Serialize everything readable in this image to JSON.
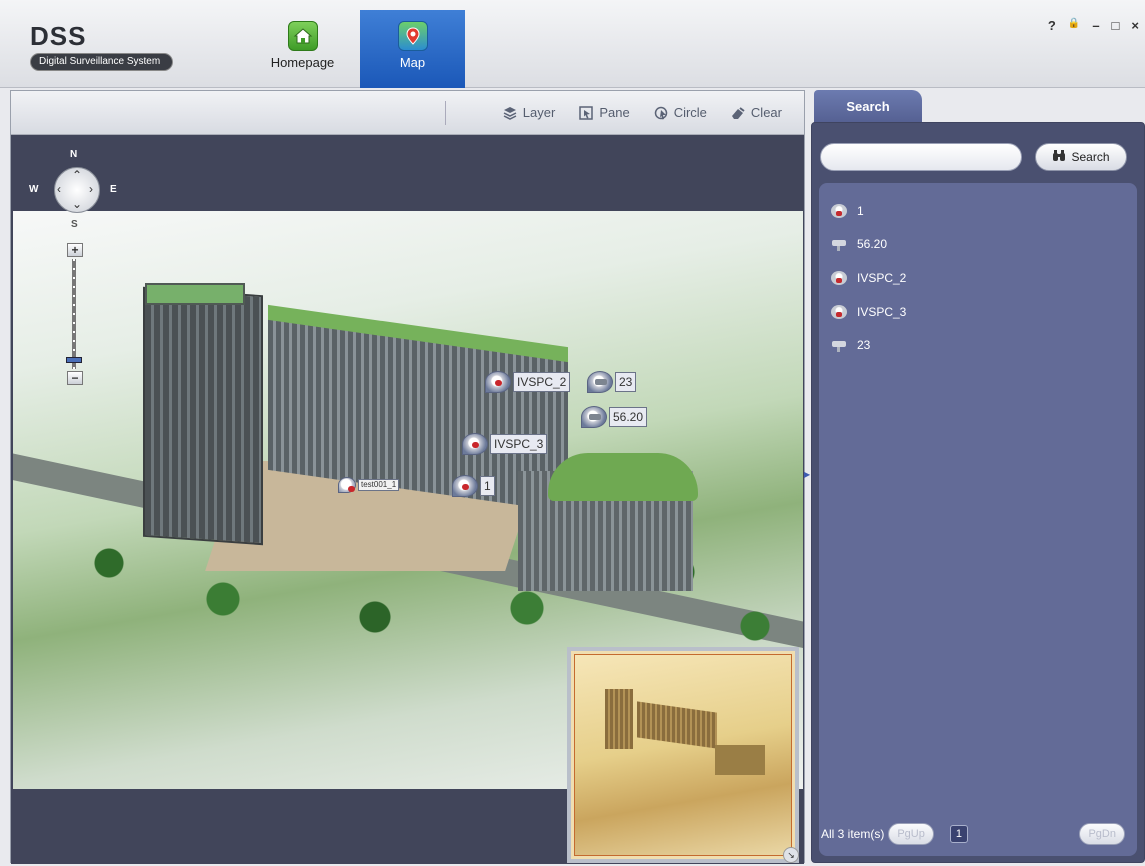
{
  "app": {
    "title": "DSS",
    "subtitle": "Digital Surveillance System"
  },
  "nav": {
    "tabs": [
      {
        "label": "Homepage",
        "icon": "house-icon",
        "active": false
      },
      {
        "label": "Map",
        "icon": "map-pin-icon",
        "active": true
      }
    ]
  },
  "window_controls": {
    "help": "?",
    "lock": "🔒",
    "minimize": "–",
    "maximize": "□",
    "close": "×"
  },
  "map_toolbar": {
    "tools": [
      {
        "label": "Layer",
        "icon": "layers-icon"
      },
      {
        "label": "Pane",
        "icon": "pane-select-icon"
      },
      {
        "label": "Circle",
        "icon": "circle-select-icon"
      },
      {
        "label": "Clear",
        "icon": "eraser-icon"
      }
    ]
  },
  "compass": {
    "n": "N",
    "s": "S",
    "w": "W",
    "e": "E",
    "zoom_in": "+",
    "zoom_out": "−"
  },
  "map_markers": [
    {
      "label": "IVSPC_2",
      "type": "dome"
    },
    {
      "label": "23",
      "type": "bullet"
    },
    {
      "label": "56.20",
      "type": "bullet"
    },
    {
      "label": "IVSPC_3",
      "type": "dome"
    },
    {
      "label": "1",
      "type": "dome"
    },
    {
      "label": "test001_1",
      "type": "dome"
    }
  ],
  "search": {
    "tab_label": "Search",
    "input_value": "",
    "input_placeholder": "",
    "button_label": "Search",
    "results": [
      {
        "label": "1",
        "type": "dome"
      },
      {
        "label": "56.20",
        "type": "bullet"
      },
      {
        "label": "IVSPC_2",
        "type": "dome"
      },
      {
        "label": "IVSPC_3",
        "type": "dome"
      },
      {
        "label": "23",
        "type": "bullet"
      }
    ],
    "pager": {
      "summary": "All 3 item(s)",
      "prev": "PgUp",
      "page": "1",
      "next": "PgDn"
    }
  },
  "colors": {
    "accent": "#1b58b8",
    "panel_bg": "#4a5070",
    "results_bg": "#636b97",
    "map_border_bg": "#41455a"
  }
}
